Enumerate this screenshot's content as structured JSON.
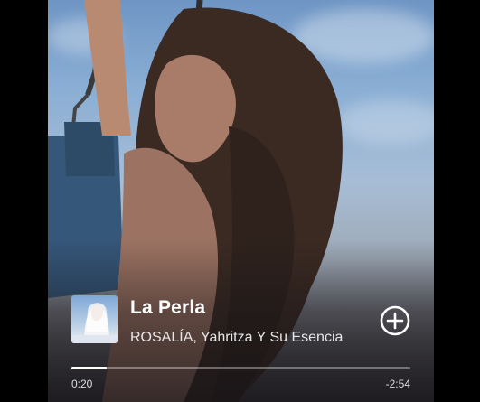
{
  "track": {
    "title": "La Perla",
    "artists": "ROSALÍA, Yahritza Y Su Esencia"
  },
  "playback": {
    "elapsed": "0:20",
    "remaining": "-2:54",
    "progress_fraction": 0.105
  },
  "icons": {
    "add": "plus-circle-icon"
  },
  "colors": {
    "text_primary": "#ffffff",
    "text_secondary": "#e6e6e6",
    "progress_fill": "#ffffff",
    "progress_track": "rgba(255,255,255,0.35)"
  }
}
